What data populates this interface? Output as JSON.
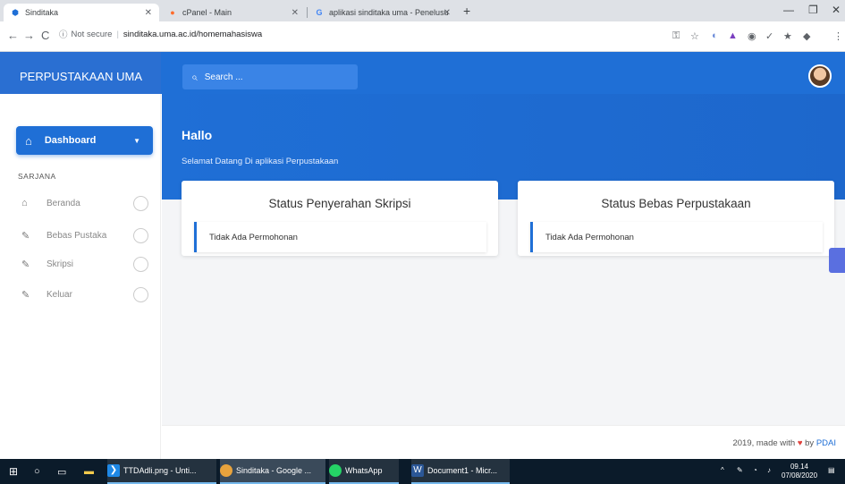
{
  "browser": {
    "tabs": [
      {
        "title": "Sinditaka",
        "icon": "sinditaka-favicon"
      },
      {
        "title": "cPanel - Main",
        "icon": "cpanel-favicon"
      },
      {
        "title": "aplikasi sinditaka uma - Penelusu",
        "icon": "google-favicon"
      }
    ],
    "new_tab": "+",
    "address": {
      "security": "Not secure",
      "url": "sinditaka.uma.ac.id/homemahasiswa"
    }
  },
  "header": {
    "brand": "PERPUSTAKAAN UMA",
    "search_placeholder": "Search ..."
  },
  "sidebar": {
    "dashboard": "Dashboard",
    "section": "SARJANA",
    "items": [
      {
        "label": "Beranda",
        "icon": "home-icon"
      },
      {
        "label": "Bebas Pustaka",
        "icon": "edit-icon"
      },
      {
        "label": "Skripsi",
        "icon": "edit-icon"
      },
      {
        "label": "Keluar",
        "icon": "edit-icon"
      }
    ]
  },
  "main": {
    "greeting": "Hallo",
    "welcome": "Selamat Datang Di aplikasi Perpustakaan",
    "cards": [
      {
        "title": "Status Penyerahan Skripsi",
        "status": "Tidak Ada Permohonan"
      },
      {
        "title": "Status Bebas Perpustakaan",
        "status": "Tidak Ada Permohonan"
      }
    ],
    "footer": {
      "prefix": "2019, made with",
      "by": "by",
      "link": "PDAI"
    }
  },
  "taskbar": {
    "apps": [
      {
        "label": "TTDAdli.png - Unti..."
      },
      {
        "label": "Sinditaka - Google ..."
      },
      {
        "label": "WhatsApp"
      },
      {
        "label": "Document1 - Micr..."
      }
    ],
    "time": "09.14",
    "date": "07/08/2020"
  },
  "colors": {
    "primary": "#1f6fd6",
    "accent_button": "#5a6fe0",
    "heart": "#e0403a"
  }
}
